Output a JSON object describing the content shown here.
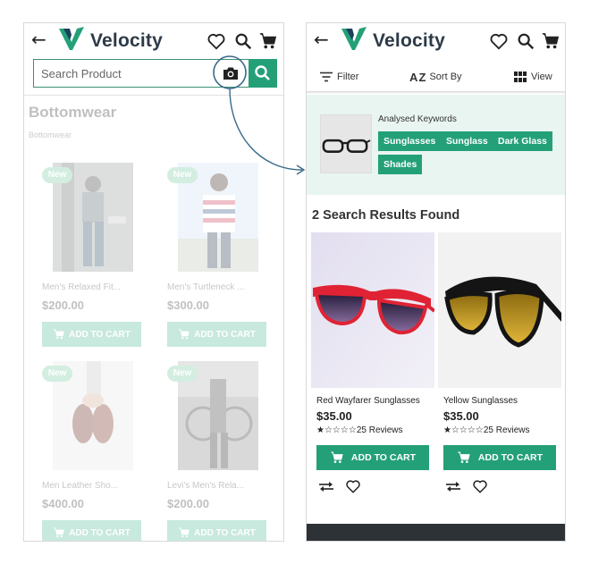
{
  "brand": {
    "name": "Velocity"
  },
  "colors": {
    "primary": "#24a079",
    "primary_faded": "#5cbf99",
    "panel_bg": "#e9f5f0",
    "brand_text": "#2d3a48",
    "footer": "#2d3237"
  },
  "left_screen": {
    "search": {
      "placeholder": "Search Product"
    },
    "icons": [
      "back-arrow-icon",
      "heart-icon",
      "search-icon",
      "cart-icon",
      "camera-icon"
    ],
    "category_title": "Bottomwear",
    "breadcrumb": "Bottomwear",
    "products": [
      {
        "badge": "New",
        "name": "Men's Relaxed Fit...",
        "price": "$200.00",
        "button": "ADD TO CART"
      },
      {
        "badge": "New",
        "name": "Men's Turtleneck ...",
        "price": "$300.00",
        "button": "ADD TO CART"
      },
      {
        "badge": "New",
        "name": "Men Leather Sho...",
        "price": "$400.00",
        "button": "ADD TO CART"
      },
      {
        "badge": "New",
        "name": "Levi's Men's Rela...",
        "price": "$200.00",
        "button": "ADD TO CART"
      }
    ]
  },
  "right_screen": {
    "toolbar": {
      "filter": "Filter",
      "sort": "Sort By",
      "sort_icon": "A Z",
      "view": "View"
    },
    "keywords": {
      "label": "Analysed Keywords",
      "chips": [
        "Sunglasses",
        "Sunglass",
        "Dark Glass",
        "Shades"
      ]
    },
    "results_title": "2 Search Results Found",
    "results": [
      {
        "name": "Red Wayfarer Sunglasses",
        "price": "$35.00",
        "rating": 1,
        "stars": "★☆☆☆☆",
        "reviews": "25 Reviews",
        "button": "ADD TO CART"
      },
      {
        "name": "Yellow Sunglasses",
        "price": "$35.00",
        "rating": 1,
        "stars": "★☆☆☆☆",
        "reviews": "25 Reviews",
        "button": "ADD TO CART"
      }
    ]
  }
}
